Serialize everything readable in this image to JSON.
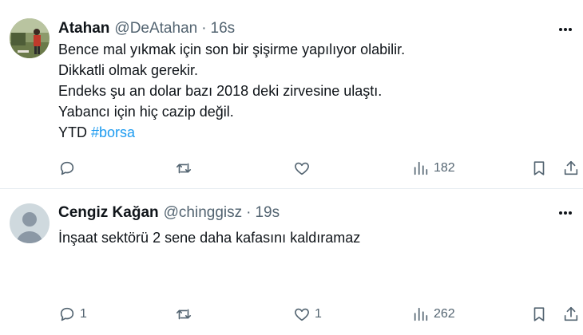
{
  "tweets": [
    {
      "name": "Atahan",
      "handle": "@DeAtahan",
      "separator": "·",
      "time": "16s",
      "lines": [
        "Bence mal yıkmak için son bir şişirme yapılıyor olabilir.",
        "Dikkatli olmak gerekir.",
        "Endeks şu an dolar bazı 2018 deki zirvesine ulaştı.",
        "Yabancı için hiç cazip değil."
      ],
      "last_line_text": "YTD",
      "hashtag": "#borsa",
      "actions": {
        "replies": "",
        "retweets": "",
        "likes": "",
        "views": "182"
      }
    },
    {
      "name": "Cengiz Kağan",
      "handle": "@chinggisz",
      "separator": "·",
      "time": "19s",
      "lines": [
        "İnşaat sektörü 2 sene daha kafasını kaldıramaz"
      ],
      "actions": {
        "replies": "1",
        "retweets": "",
        "likes": "1",
        "views": "262"
      }
    }
  ],
  "icons": {
    "more": "more-horizontal-icon",
    "reply": "reply-icon",
    "retweet": "retweet-icon",
    "like": "heart-icon",
    "views": "analytics-icon",
    "bookmark": "bookmark-icon",
    "share": "share-icon"
  },
  "colors": {
    "text": "#0f1419",
    "secondary": "#536471",
    "hashtag": "#1d9bf0",
    "divider": "#e6ecf0"
  }
}
